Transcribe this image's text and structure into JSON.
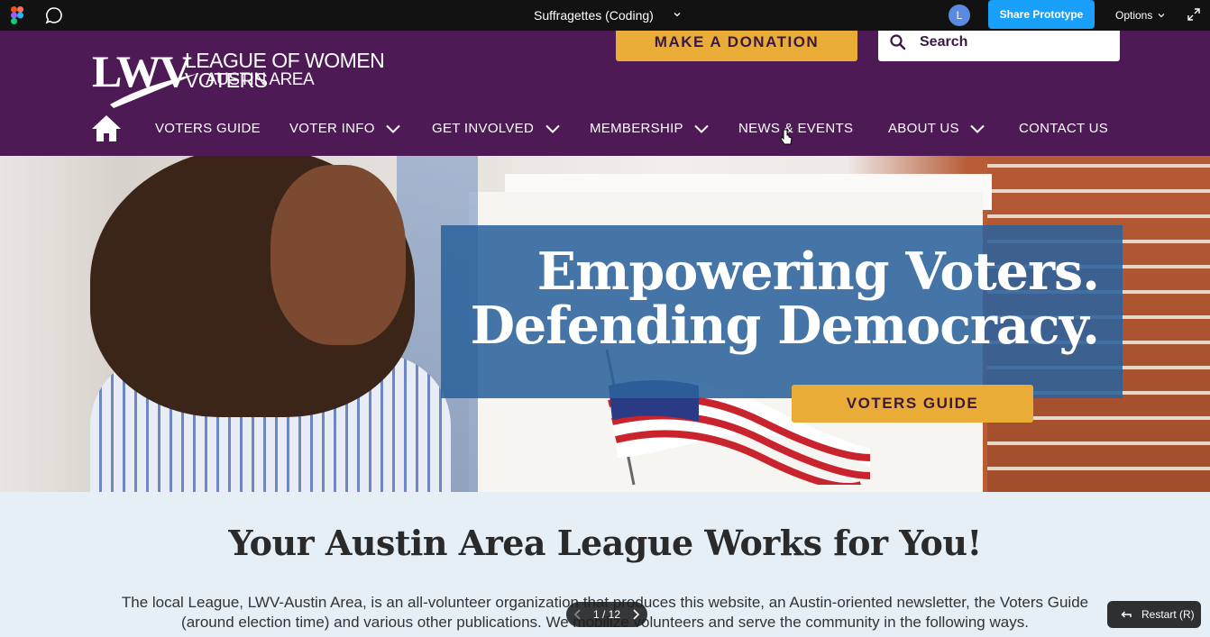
{
  "figma": {
    "file_title": "Suffragettes (Coding)",
    "avatar_initial": "L",
    "share_label": "Share Prototype",
    "options_label": "Options",
    "page_count": "1 / 12",
    "restart_label": "Restart (R)"
  },
  "header": {
    "logo_mark": "LWV",
    "org_name": "LEAGUE OF WOMEN VOTERS",
    "org_sub": "AUSTIN AREA",
    "donate_label": "MAKE A DONATION",
    "search_placeholder": "Search",
    "nav": [
      {
        "label": "VOTERS GUIDE"
      },
      {
        "label": "VOTER INFO"
      },
      {
        "label": "GET INVOLVED"
      },
      {
        "label": "MEMBERSHIP"
      },
      {
        "label": "NEWS & EVENTS"
      },
      {
        "label": "ABOUT US"
      },
      {
        "label": "CONTACT US"
      }
    ]
  },
  "hero": {
    "line1": "Empowering Voters.",
    "line2": "Defending Democracy.",
    "cta_label": "VOTERS GUIDE"
  },
  "intro": {
    "heading": "Your Austin Area League Works for You!",
    "body": "The local League, LWV-Austin Area, is an all-volunteer organization that produces this website, an Austin-oriented newsletter, the Voters Guide (around election time) and various other publications. We mobilize volunteers and serve the community in the following ways."
  },
  "colors": {
    "brand_purple": "#4d1a56",
    "accent_gold": "#e9ad37",
    "hero_blue": "#2c629c",
    "figma_blue": "#18a0fb"
  }
}
